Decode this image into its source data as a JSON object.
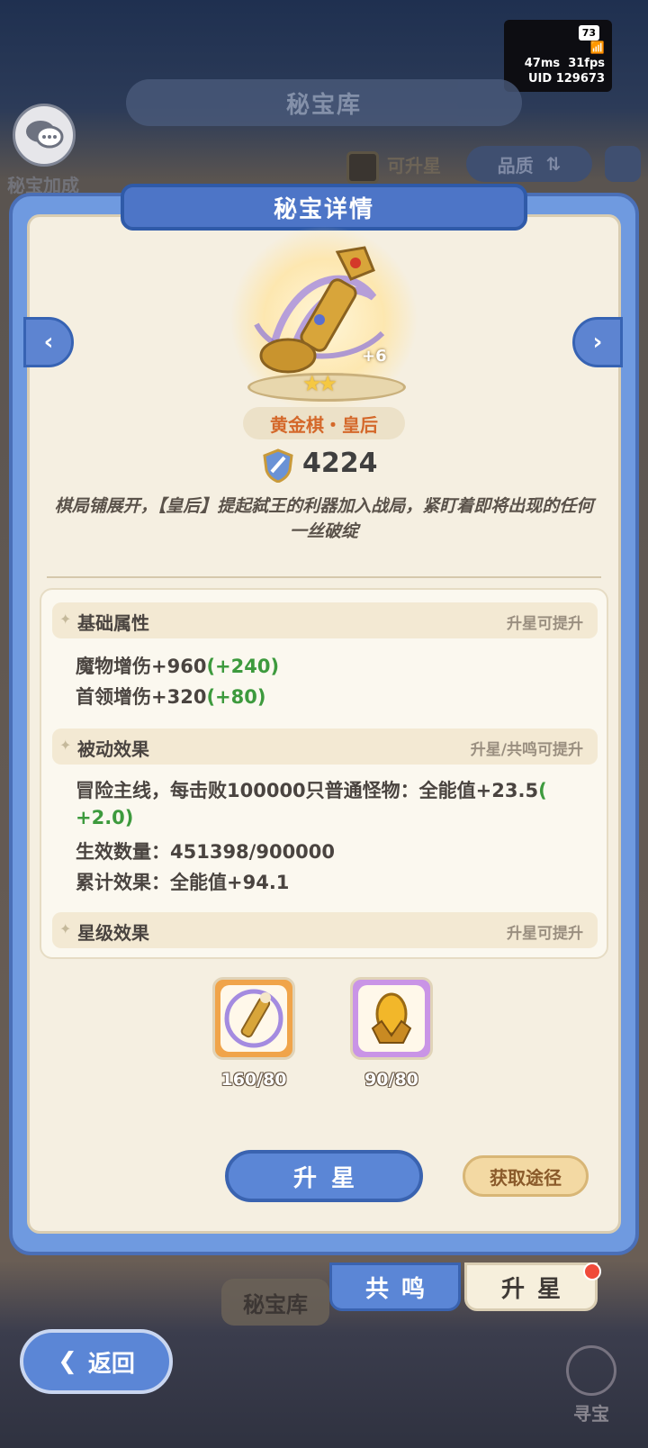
{
  "status": {
    "battery": "73",
    "ping": "47ms",
    "fps": "31fps",
    "uid_label": "UID",
    "uid": "129673"
  },
  "background": {
    "title": "秘宝库",
    "side_label": "秘宝加成",
    "filter_label": "可升星",
    "quality_label": "品质",
    "tab_label": "秘宝库"
  },
  "panel": {
    "title": "秘宝详情",
    "item": {
      "plus_level": "+6",
      "stars": "★★",
      "name": "黄金棋・皇后",
      "power": "4224",
      "description": "棋局铺展开，【皇后】提起弑王的利器加入战局，紧盯着即将出现的任何一丝破绽"
    },
    "sections": {
      "base": {
        "title": "基础属性",
        "hint": "升星可提升",
        "stats": [
          {
            "text": "魔物增伤+960",
            "bonus": "(+240)"
          },
          {
            "text": "首领增伤+320",
            "bonus": "(+80)"
          }
        ]
      },
      "passive": {
        "title": "被动效果",
        "hint": "升星/共鸣可提升",
        "line1": "冒险主线，每击败100000只普通怪物：全能值+23.5",
        "line1_bonus": "(",
        "line2_bonus": "+2.0)",
        "line3": "生效数量：451398/900000",
        "line4": "累计效果：全能值+94.1"
      },
      "star": {
        "title": "星级效果",
        "hint": "升星可提升"
      }
    },
    "materials": [
      {
        "count": "160/80",
        "icon": "queen-piece-icon"
      },
      {
        "count": "90/80",
        "icon": "gold-egg-icon"
      }
    ],
    "upgrade_button": "升星",
    "obtain_button": "获取途径"
  },
  "tabs": {
    "resonance": "共鸣",
    "upgrade": "升星"
  },
  "back_button": "返回",
  "treasure_button": "寻宝",
  "colors": {
    "accent_blue": "#5b86d6",
    "bonus_green": "#3d9a3d",
    "name_orange": "#d4682a"
  }
}
